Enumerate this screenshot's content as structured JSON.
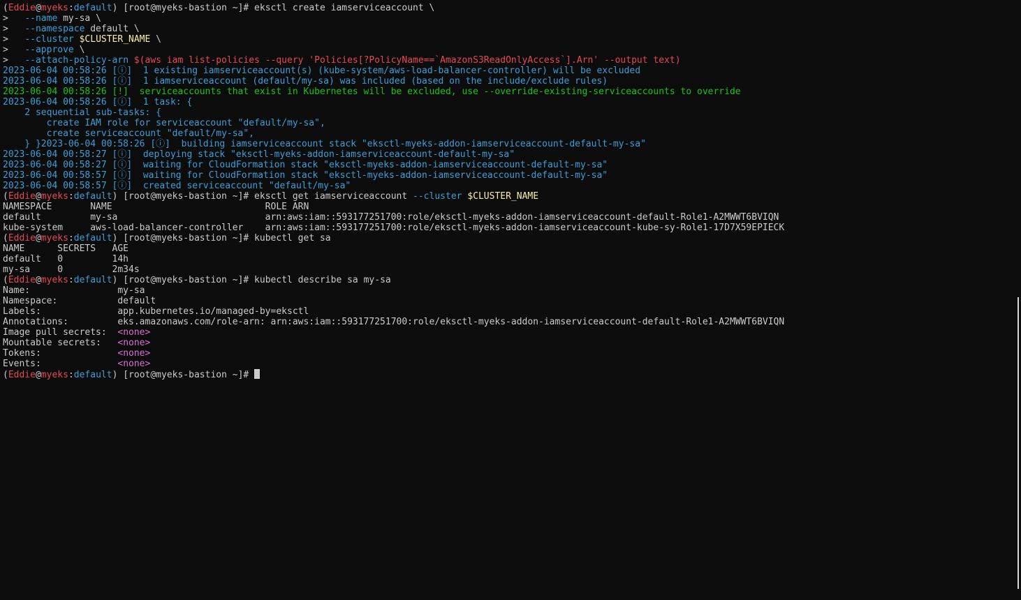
{
  "colors": {
    "background": "#0c0c0c",
    "text": "#cccccc",
    "red": "#e74856",
    "blue": "#3b9fd8",
    "green": "#16c60c",
    "yellow": "#f9f1a5",
    "magenta": "#d670d6"
  },
  "terminal": {
    "lines": [
      [
        {
          "t": "(",
          "c": "white"
        },
        {
          "t": "Eddie",
          "c": "red"
        },
        {
          "t": "@",
          "c": "white"
        },
        {
          "t": "myeks",
          "c": "red"
        },
        {
          "t": ":",
          "c": "white"
        },
        {
          "t": "default",
          "c": "blue"
        },
        {
          "t": ") [root@myeks-bastion ~]# eksctl create iamserviceaccount \\",
          "c": "white"
        }
      ],
      [
        {
          "t": ">   ",
          "c": "white"
        },
        {
          "t": "--name",
          "c": "blue"
        },
        {
          "t": " my-sa \\",
          "c": "white"
        }
      ],
      [
        {
          "t": ">   ",
          "c": "white"
        },
        {
          "t": "--namespace",
          "c": "blue"
        },
        {
          "t": " default \\",
          "c": "white"
        }
      ],
      [
        {
          "t": ">   ",
          "c": "white"
        },
        {
          "t": "--cluster",
          "c": "blue"
        },
        {
          "t": " ",
          "c": "white"
        },
        {
          "t": "$CLUSTER_NAME",
          "c": "yellow"
        },
        {
          "t": " \\",
          "c": "white"
        }
      ],
      [
        {
          "t": ">   ",
          "c": "white"
        },
        {
          "t": "--approve",
          "c": "blue"
        },
        {
          "t": " \\",
          "c": "white"
        }
      ],
      [
        {
          "t": ">   ",
          "c": "white"
        },
        {
          "t": "--attach-policy-arn",
          "c": "blue"
        },
        {
          "t": " ",
          "c": "white"
        },
        {
          "t": "$(aws iam list-policies --query 'Policies[?PolicyName==`AmazonS3ReadOnlyAccess`].Arn' --output text)",
          "c": "red"
        }
      ],
      [
        {
          "t": "2023-06-04 00:58:26 [ⓘ]  1 existing iamserviceaccount(s) (kube-system/aws-load-balancer-controller) will be excluded",
          "c": "blue"
        }
      ],
      [
        {
          "t": "2023-06-04 00:58:26 [ⓘ]  1 iamserviceaccount (default/my-sa) was included (based on the include/exclude rules)",
          "c": "blue"
        }
      ],
      [
        {
          "t": "2023-06-04 00:58:26 [!]  serviceaccounts that exist in Kubernetes will be excluded, use --override-existing-serviceaccounts to override",
          "c": "green"
        }
      ],
      [
        {
          "t": "2023-06-04 00:58:26 [ⓘ]  1 task: {",
          "c": "blue"
        }
      ],
      [
        {
          "t": "    2 sequential sub-tasks: {",
          "c": "blue"
        }
      ],
      [
        {
          "t": "        create IAM role for serviceaccount \"default/my-sa\",",
          "c": "blue"
        }
      ],
      [
        {
          "t": "        create serviceaccount \"default/my-sa\",",
          "c": "blue"
        }
      ],
      [
        {
          "t": "    } }2023-06-04 00:58:26 [ⓘ]  building iamserviceaccount stack \"eksctl-myeks-addon-iamserviceaccount-default-my-sa\"",
          "c": "blue"
        }
      ],
      [
        {
          "t": "2023-06-04 00:58:27 [ⓘ]  deploying stack \"eksctl-myeks-addon-iamserviceaccount-default-my-sa\"",
          "c": "blue"
        }
      ],
      [
        {
          "t": "2023-06-04 00:58:27 [ⓘ]  waiting for CloudFormation stack \"eksctl-myeks-addon-iamserviceaccount-default-my-sa\"",
          "c": "blue"
        }
      ],
      [
        {
          "t": "2023-06-04 00:58:57 [ⓘ]  waiting for CloudFormation stack \"eksctl-myeks-addon-iamserviceaccount-default-my-sa\"",
          "c": "blue"
        }
      ],
      [
        {
          "t": "2023-06-04 00:58:57 [ⓘ]  created serviceaccount \"default/my-sa\"",
          "c": "blue"
        }
      ],
      [
        {
          "t": "(",
          "c": "white"
        },
        {
          "t": "Eddie",
          "c": "red"
        },
        {
          "t": "@",
          "c": "white"
        },
        {
          "t": "myeks",
          "c": "red"
        },
        {
          "t": ":",
          "c": "white"
        },
        {
          "t": "default",
          "c": "blue"
        },
        {
          "t": ") [root@myeks-bastion ~]# eksctl get iamserviceaccount ",
          "c": "white"
        },
        {
          "t": "--cluster",
          "c": "blue"
        },
        {
          "t": " ",
          "c": "white"
        },
        {
          "t": "$CLUSTER_NAME",
          "c": "yellow"
        }
      ],
      [
        {
          "t": "NAMESPACE       NAME                            ROLE ARN",
          "c": "white"
        }
      ],
      [
        {
          "t": "default         my-sa                           arn:aws:iam::593177251700:role/eksctl-myeks-addon-iamserviceaccount-default-Role1-A2MWWT6BVIQN",
          "c": "white"
        }
      ],
      [
        {
          "t": "kube-system     aws-load-balancer-controller    arn:aws:iam::593177251700:role/eksctl-myeks-addon-iamserviceaccount-kube-sy-Role1-17D7X59EPIECK",
          "c": "white"
        }
      ],
      [
        {
          "t": "(",
          "c": "white"
        },
        {
          "t": "Eddie",
          "c": "red"
        },
        {
          "t": "@",
          "c": "white"
        },
        {
          "t": "myeks",
          "c": "red"
        },
        {
          "t": ":",
          "c": "white"
        },
        {
          "t": "default",
          "c": "blue"
        },
        {
          "t": ") [root@myeks-bastion ~]# kubectl get sa",
          "c": "white"
        }
      ],
      [
        {
          "t": "NAME      SECRETS   AGE",
          "c": "white"
        }
      ],
      [
        {
          "t": "default   0         14h",
          "c": "white"
        }
      ],
      [
        {
          "t": "my-sa     0         2m34s",
          "c": "white"
        }
      ],
      [
        {
          "t": "(",
          "c": "white"
        },
        {
          "t": "Eddie",
          "c": "red"
        },
        {
          "t": "@",
          "c": "white"
        },
        {
          "t": "myeks",
          "c": "red"
        },
        {
          "t": ":",
          "c": "white"
        },
        {
          "t": "default",
          "c": "blue"
        },
        {
          "t": ") [root@myeks-bastion ~]# kubectl describe sa my-sa",
          "c": "white"
        }
      ],
      [
        {
          "t": "Name:                my-sa",
          "c": "white"
        }
      ],
      [
        {
          "t": "Namespace:           default",
          "c": "white"
        }
      ],
      [
        {
          "t": "Labels:              app.kubernetes.io/managed-by=eksctl",
          "c": "white"
        }
      ],
      [
        {
          "t": "Annotations:         eks.amazonaws.com/role-arn: arn:aws:iam::593177251700:role/eksctl-myeks-addon-iamserviceaccount-default-Role1-A2MWWT6BVIQN",
          "c": "white"
        }
      ],
      [
        {
          "t": "Image pull secrets:  ",
          "c": "white"
        },
        {
          "t": "<none>",
          "c": "magenta"
        }
      ],
      [
        {
          "t": "Mountable secrets:   ",
          "c": "white"
        },
        {
          "t": "<none>",
          "c": "magenta"
        }
      ],
      [
        {
          "t": "Tokens:              ",
          "c": "white"
        },
        {
          "t": "<none>",
          "c": "magenta"
        }
      ],
      [
        {
          "t": "Events:              ",
          "c": "white"
        },
        {
          "t": "<none>",
          "c": "magenta"
        }
      ],
      [
        {
          "t": "(",
          "c": "white"
        },
        {
          "t": "Eddie",
          "c": "red"
        },
        {
          "t": "@",
          "c": "white"
        },
        {
          "t": "myeks",
          "c": "red"
        },
        {
          "t": ":",
          "c": "white"
        },
        {
          "t": "default",
          "c": "blue"
        },
        {
          "t": ") [root@myeks-bastion ~]# ",
          "c": "white"
        }
      ]
    ]
  }
}
